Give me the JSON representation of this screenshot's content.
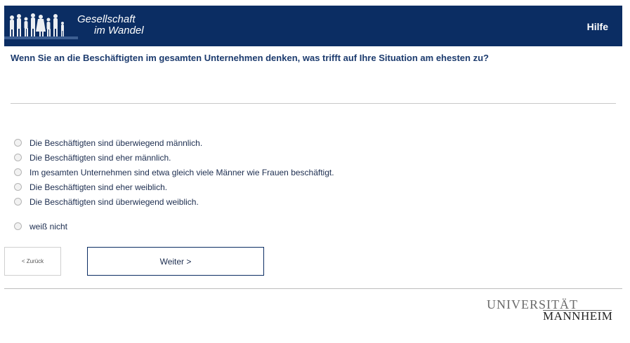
{
  "header": {
    "logo_line1": "Gesellschaft",
    "logo_line2": "im Wandel",
    "help_label": "Hilfe",
    "background_color": "#0b2d63"
  },
  "question": {
    "text": "Wenn Sie an die Beschäftigten im gesamten Unternehmen denken, was trifft auf Ihre Situation am ehesten zu?"
  },
  "options": [
    {
      "label": "Die Beschäftigten sind überwiegend männlich.",
      "selected": false
    },
    {
      "label": "Die Beschäftigten sind eher männlich.",
      "selected": false
    },
    {
      "label": "Im gesamten Unternehmen sind etwa gleich viele Männer wie Frauen beschäftigt.",
      "selected": false
    },
    {
      "label": "Die Beschäftigten sind eher weiblich.",
      "selected": false
    },
    {
      "label": "Die Beschäftigten sind überwiegend weiblich.",
      "selected": false
    },
    {
      "label": "weiß nicht",
      "selected": false
    }
  ],
  "navigation": {
    "back_label": "< Zurück",
    "next_label": "Weiter >"
  },
  "footer": {
    "university_line1": "UNIVERSITÄT",
    "university_line2": "MANNHEIM"
  }
}
